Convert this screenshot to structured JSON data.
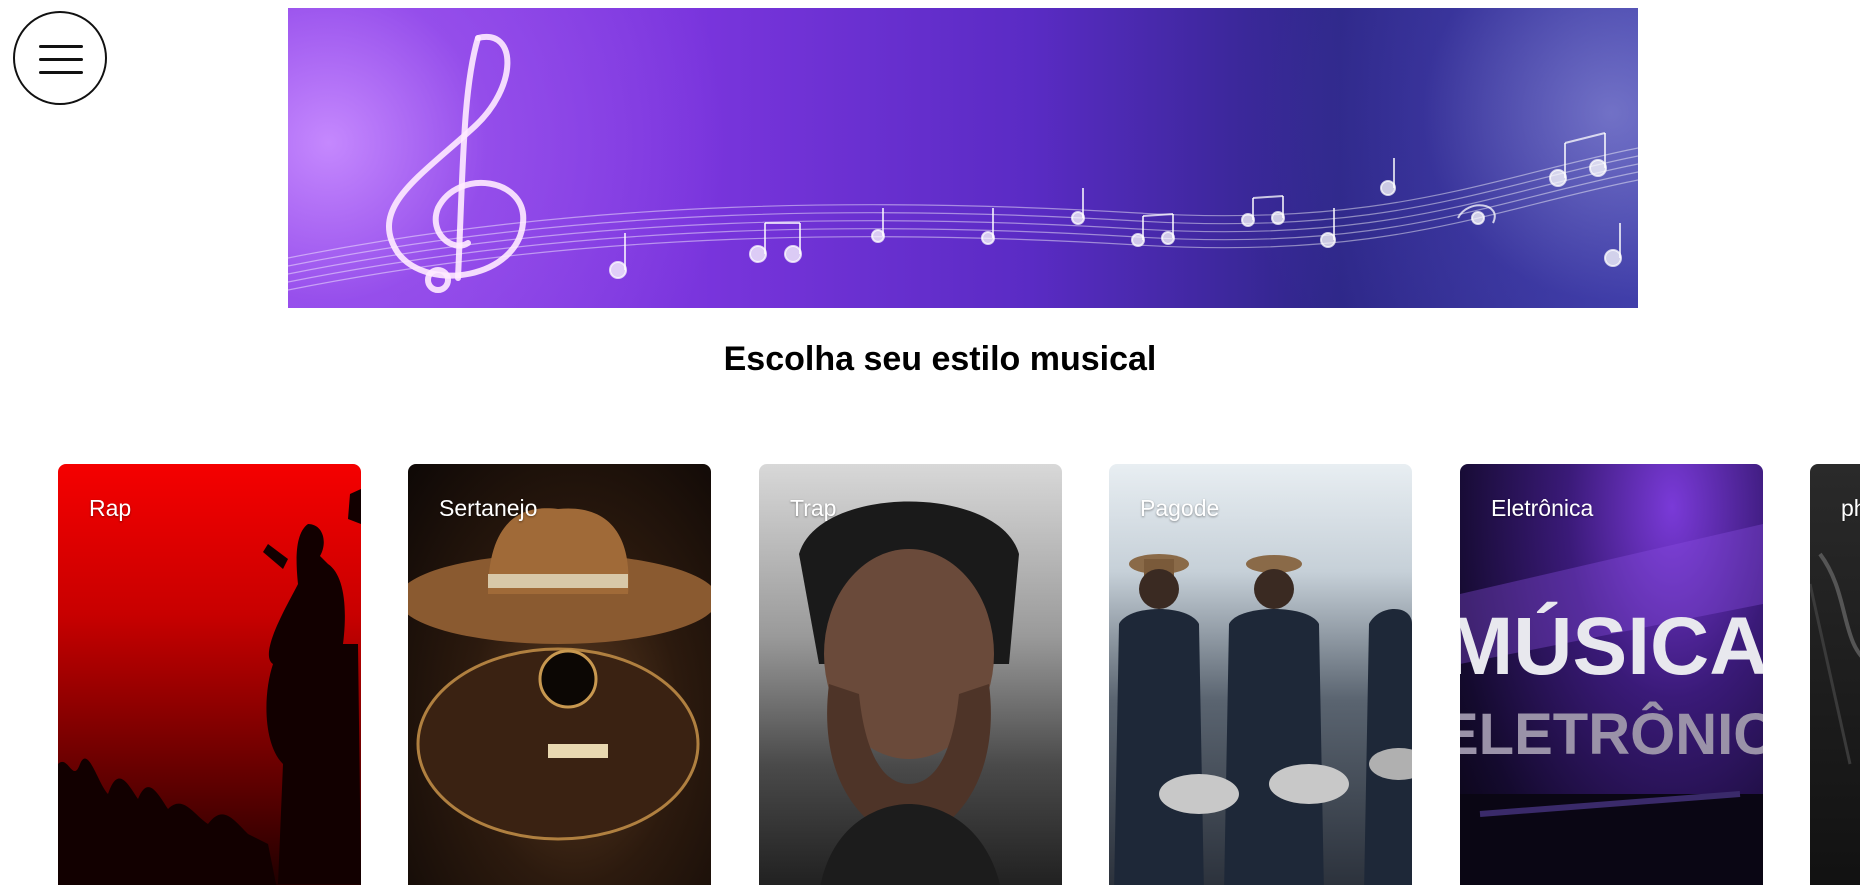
{
  "menu": {
    "icon": "hamburger-menu-icon"
  },
  "banner": {
    "icon": "treble-clef-music-notes-banner"
  },
  "heading": "Escolha seu estilo musical",
  "genres": [
    {
      "label": "Rap"
    },
    {
      "label": "Sertanejo"
    },
    {
      "label": "Trap"
    },
    {
      "label": "Pagode"
    },
    {
      "label": "Eletrônica"
    },
    {
      "label": "ph"
    }
  ],
  "card_art_text": {
    "eletronica_line1": "MÚSICA",
    "eletronica_line2": "ELETRÔNICA"
  },
  "colors": {
    "banner_purple": "#7a35dd",
    "banner_navy": "#2c2686",
    "rap_red": "#f50000"
  }
}
